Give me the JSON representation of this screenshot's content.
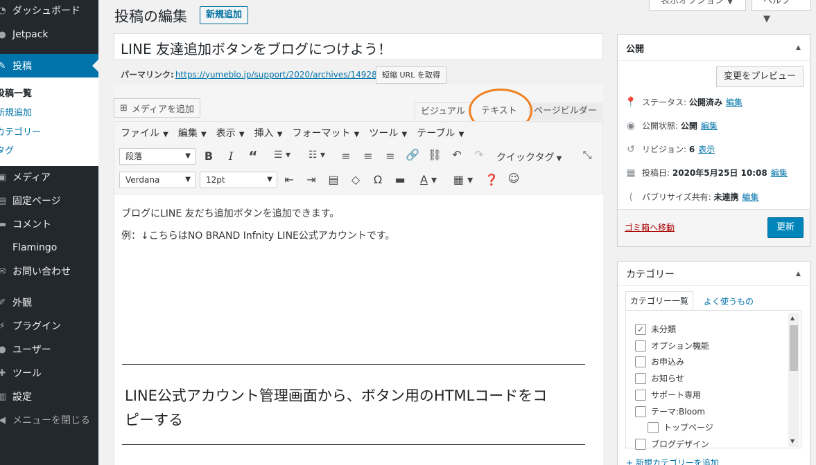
{
  "sidebar": {
    "items": [
      {
        "label": "ダッシュボード"
      },
      {
        "label": "Jetpack"
      },
      {
        "label": "投稿"
      },
      {
        "label": "メディア"
      },
      {
        "label": "固定ページ"
      },
      {
        "label": "コメント"
      },
      {
        "label": "Flamingo"
      },
      {
        "label": "お問い合わせ"
      },
      {
        "label": "外観"
      },
      {
        "label": "プラグイン"
      },
      {
        "label": "ユーザー"
      },
      {
        "label": "ツール"
      },
      {
        "label": "設定"
      },
      {
        "label": "メニューを閉じる"
      }
    ],
    "submenu": [
      {
        "label": "投稿一覧"
      },
      {
        "label": "新規追加"
      },
      {
        "label": "カテゴリー"
      },
      {
        "label": "タグ"
      }
    ]
  },
  "header": {
    "title": "投稿の編集",
    "add_new_label": "新規追加",
    "screen_options_label": "表示オプション ▼",
    "help_label": "ヘルプ ▼"
  },
  "post": {
    "title": "LINE 友達追加ボタンをブログにつけよう！",
    "permalink_label": "パーマリンク:",
    "permalink_url": "https://yumeblo.jp/support/2020/archives/14928",
    "shortlink_label": "短縮 URL を取得"
  },
  "editor": {
    "add_media_label": "メディアを追加",
    "tabs": [
      {
        "label": "ビジュアル"
      },
      {
        "label": "テキスト"
      },
      {
        "label": "ページビルダー"
      }
    ],
    "menubar": [
      {
        "label": "ファイル"
      },
      {
        "label": "編集"
      },
      {
        "label": "表示"
      },
      {
        "label": "挿入"
      },
      {
        "label": "フォーマット"
      },
      {
        "label": "ツール"
      },
      {
        "label": "テーブル"
      }
    ],
    "format_select": "段落",
    "font_select": "Verdana",
    "size_select": "12pt",
    "quicktag_label": "クイックタグ",
    "content": {
      "line1": "ブログにLINE 友だち追加ボタンを追加できます。",
      "line2": "例：↓こちらはNO BRAND Infnity LINE公式アカウントです。",
      "heading_line1": "LINE公式アカウント管理画面から、ボタン用のHTMLコードをコ",
      "heading_line2": "ピーする"
    }
  },
  "publish_box": {
    "title": "公開",
    "preview_label": "変更をプレビュー",
    "status_label": "ステータス:",
    "status_value": "公開済み",
    "visibility_label": "公開状態:",
    "visibility_value": "公開",
    "revision_label": "リビジョン:",
    "revision_value": "6",
    "revision_link": "表示",
    "date_label": "投稿日:",
    "date_value": "2020年5月25日 10:08",
    "publicize_label": "パブリサイズ共有:",
    "publicize_value": "未連携",
    "edit_link": "編集",
    "trash_label": "ゴミ箱へ移動",
    "update_label": "更新"
  },
  "category_box": {
    "title": "カテゴリー",
    "tab_all": "カテゴリー一覧",
    "tab_popular": "よく使うもの",
    "items": [
      {
        "label": "未分類",
        "checked": true
      },
      {
        "label": "オプション機能",
        "checked": false
      },
      {
        "label": "お申込み",
        "checked": false
      },
      {
        "label": "お知らせ",
        "checked": false
      },
      {
        "label": "サポート専用",
        "checked": false
      },
      {
        "label": "テーマ:Bloom",
        "checked": false
      },
      {
        "label": "トップページ",
        "checked": false
      },
      {
        "label": "ブログデザイン",
        "checked": false
      }
    ],
    "add_link": "+ 新規カテゴリーを追加"
  },
  "colors": {
    "sidebar_bg": "#23282d",
    "accent": "#0073aa",
    "highlight_ring": "#f0801f",
    "update_button": "#0085ba"
  }
}
